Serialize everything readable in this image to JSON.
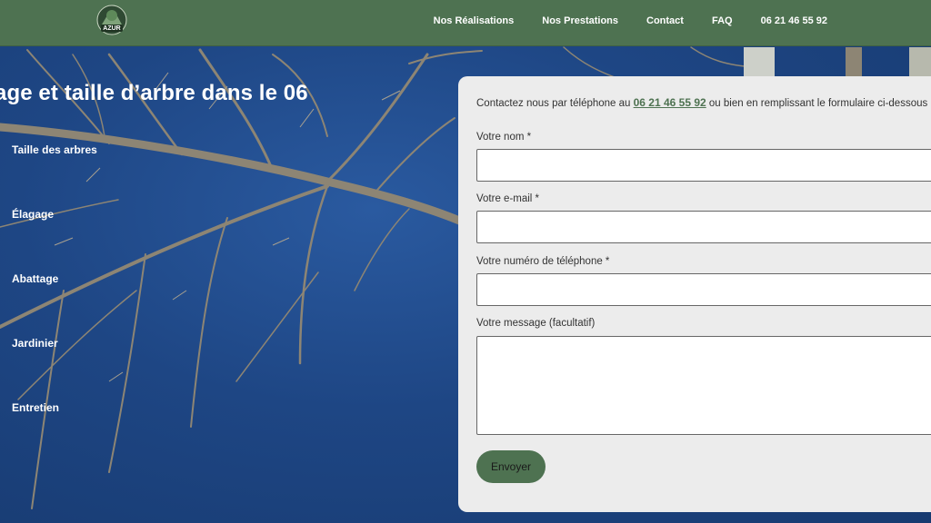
{
  "header": {
    "logo_text": "AZUR",
    "nav": [
      {
        "label": "Nos Réalisations"
      },
      {
        "label": "Nos Prestations"
      },
      {
        "label": "Contact"
      },
      {
        "label": "FAQ"
      },
      {
        "label": "06 21 46 55 92"
      }
    ]
  },
  "hero": {
    "title": "age et taille d’arbre dans le 06",
    "services": [
      "Taille des arbres",
      "Élagage",
      "Abattage",
      "Jardinier",
      "Entretien"
    ]
  },
  "contact": {
    "intro_before": "Contactez nous par téléphone au ",
    "phone": "06 21 46 55 92",
    "intro_after": " ou bien en remplissant le formulaire ci-dessous",
    "name_label": "Votre nom *",
    "email_label": "Votre e-mail *",
    "tel_label": "Votre numéro de téléphone *",
    "message_label": "Votre message (facultatif)",
    "name_value": "",
    "email_value": "",
    "tel_value": "",
    "message_value": "",
    "submit_label": "Envoyer"
  },
  "colors": {
    "brand_green": "#4e7251",
    "sky_blue": "#1e4684",
    "panel_bg": "#ececec"
  }
}
